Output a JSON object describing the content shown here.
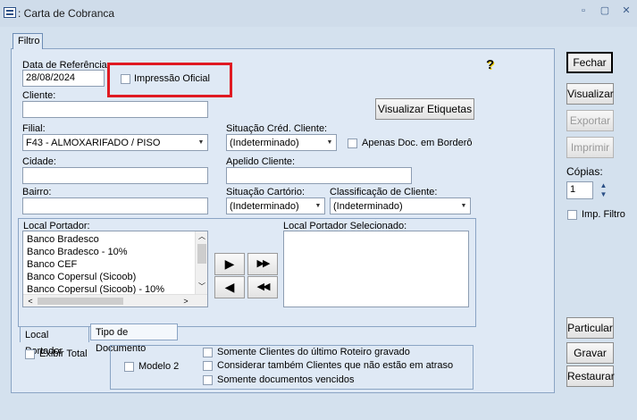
{
  "window": {
    "title": ": Carta de Cobranca",
    "minimize_glyph": "▫",
    "maximize_glyph": "▢",
    "close_glyph": "✕"
  },
  "tabs": {
    "top": "Filtro"
  },
  "form": {
    "data_ref_label": "Data de Referência:",
    "data_ref_value": "28/08/2024",
    "impressao_oficial_label": "Impressão Oficial",
    "cliente_label": "Cliente:",
    "cliente_value": "",
    "visualizar_etiquetas": "Visualizar Etiquetas",
    "filial_label": "Filial:",
    "filial_value": "F43 - ALMOXARIFADO / PISO",
    "situacao_cred_label": "Situação Créd. Cliente:",
    "situacao_cred_value": "(Indeterminado)",
    "apenas_doc_label": "Apenas Doc. em Borderô",
    "cidade_label": "Cidade:",
    "apelido_label": "Apelido Cliente:",
    "bairro_label": "Bairro:",
    "situacao_cartorio_label": "Situação Cartório:",
    "situacao_cartorio_value": "(Indeterminado)",
    "classificacao_label": "Classificação de Cliente:",
    "classificacao_value": "(Indeterminado)",
    "local_portador_label": "Local Portador:",
    "local_portador_items": [
      "Banco Bradesco",
      "Banco Bradesco - 10%",
      "Banco CEF",
      "Banco Copersul (Sicoob)",
      "Banco Copersul (Sicoob) - 10%"
    ],
    "local_portador_sel_label": "Local Portador Selecionado:",
    "btn_move_one": "▶",
    "btn_move_all": "▶▶",
    "btn_back_one": "◀",
    "btn_back_all": "◀◀",
    "bottom_tab_1": "Local Portador",
    "bottom_tab_2": "Tipo de Documento",
    "exibir_total": "Exibir Total",
    "modelo2": "Modelo 2",
    "opt1": "Somente Clientes do último Roteiro gravado",
    "opt2": "Considerar também Clientes que não estão em atraso",
    "opt3": "Somente documentos vencidos",
    "help_glyph": "?"
  },
  "side": {
    "fechar": "Fechar",
    "visualizar": "Visualizar",
    "exportar": "Exportar",
    "imprimir": "Imprimir",
    "copias_label": "Cópias:",
    "copias_value": "1",
    "imp_filtro": "Imp. Filtro",
    "particular": "Particular",
    "gravar": "Gravar",
    "restaurar": "Restaurar"
  },
  "colors": {
    "highlight_box": "#e01a22",
    "frame": "#d4e1ee",
    "panel": "#dfe9f5"
  }
}
